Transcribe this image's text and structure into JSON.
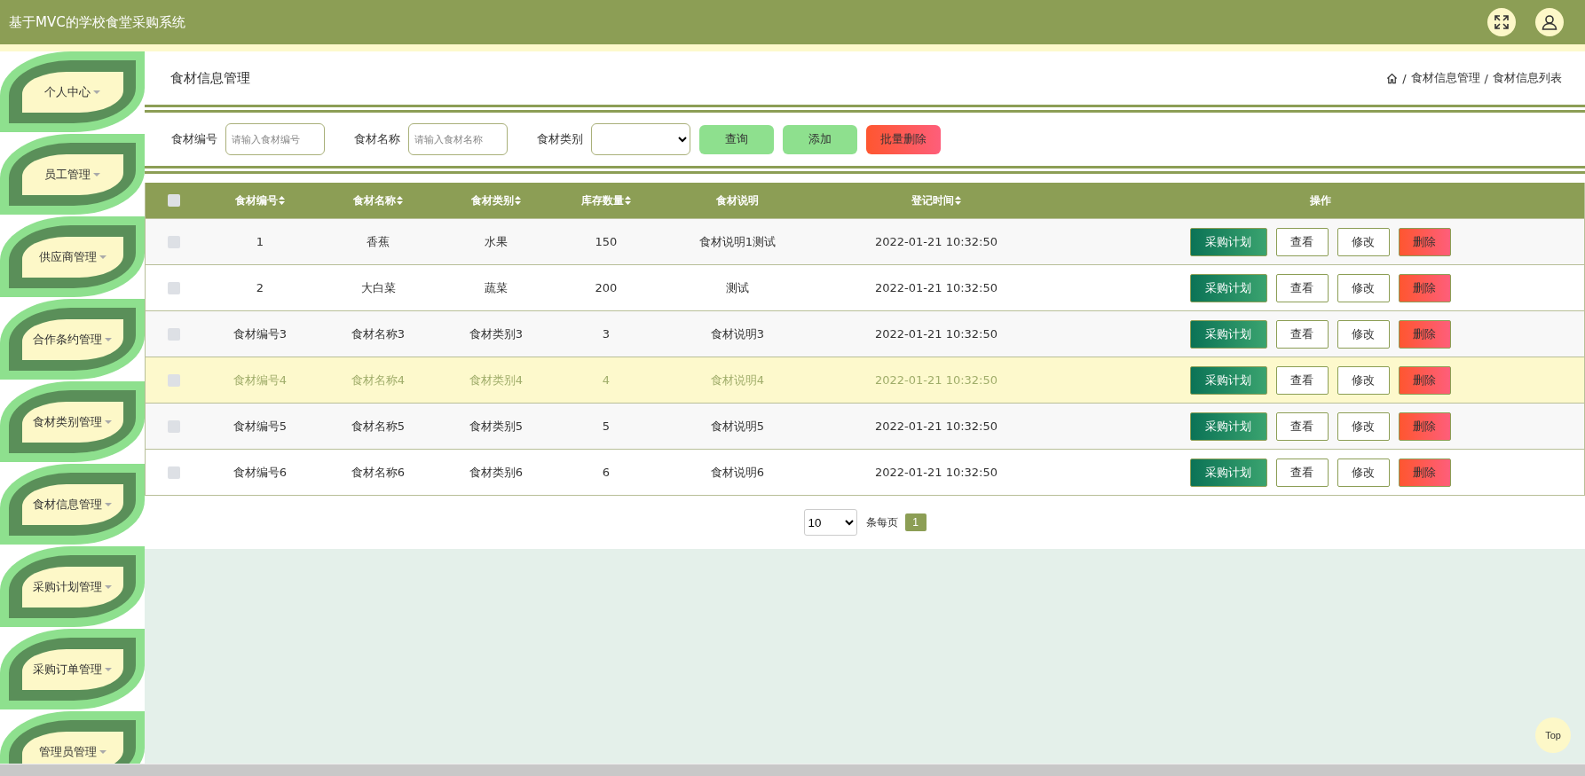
{
  "header": {
    "title": "基于MVC的学校食堂采购系统"
  },
  "sidebar": {
    "items": [
      {
        "label": "个人中心"
      },
      {
        "label": "员工管理"
      },
      {
        "label": "供应商管理"
      },
      {
        "label": "合作条约管理"
      },
      {
        "label": "食材类别管理"
      },
      {
        "label": "食材信息管理"
      },
      {
        "label": "采购计划管理"
      },
      {
        "label": "采购订单管理"
      },
      {
        "label": "管理员管理"
      }
    ]
  },
  "page": {
    "title": "食材信息管理",
    "breadcrumb": [
      {
        "separator": "/",
        "label": "食材信息管理"
      },
      {
        "separator": "/",
        "label": "食材信息列表"
      }
    ]
  },
  "search": {
    "fields": [
      {
        "kind": "input",
        "label": "食材编号",
        "placeholder": "请输入食材编号"
      },
      {
        "kind": "input",
        "label": "食材名称",
        "placeholder": "请输入食材名称"
      },
      {
        "kind": "select",
        "label": "食材类别"
      }
    ],
    "buttons": [
      {
        "kind": "query",
        "label": "查询"
      },
      {
        "kind": "add",
        "label": "添加"
      },
      {
        "kind": "danger",
        "label": "批量删除"
      }
    ]
  },
  "table": {
    "select_all_checked": false,
    "columns": [
      {
        "label": "食材编号",
        "sortable": true
      },
      {
        "label": "食材名称",
        "sortable": true
      },
      {
        "label": "食材类别",
        "sortable": true
      },
      {
        "label": "库存数量",
        "sortable": true
      },
      {
        "label": "食材说明",
        "sortable": false
      },
      {
        "label": "登记时间",
        "sortable": true
      },
      {
        "label": "操作",
        "sortable": false
      }
    ],
    "rows": [
      {
        "checked": false,
        "hovered": false,
        "cells": [
          "1",
          "香蕉",
          "水果",
          "150",
          "食材说明1测试",
          "2022-01-21 10:32:50"
        ],
        "actions": [
          "采购计划",
          "查看",
          "修改",
          "删除"
        ]
      },
      {
        "checked": false,
        "hovered": false,
        "cells": [
          "2",
          "大白菜",
          "蔬菜",
          "200",
          "测试",
          "2022-01-21 10:32:50"
        ],
        "actions": [
          "采购计划",
          "查看",
          "修改",
          "删除"
        ]
      },
      {
        "checked": false,
        "hovered": false,
        "cells": [
          "食材编号3",
          "食材名称3",
          "食材类别3",
          "3",
          "食材说明3",
          "2022-01-21 10:32:50"
        ],
        "actions": [
          "采购计划",
          "查看",
          "修改",
          "删除"
        ]
      },
      {
        "checked": false,
        "hovered": true,
        "cells": [
          "食材编号4",
          "食材名称4",
          "食材类别4",
          "4",
          "食材说明4",
          "2022-01-21 10:32:50"
        ],
        "actions": [
          "采购计划",
          "查看",
          "修改",
          "删除"
        ]
      },
      {
        "checked": false,
        "hovered": false,
        "cells": [
          "食材编号5",
          "食材名称5",
          "食材类别5",
          "5",
          "食材说明5",
          "2022-01-21 10:32:50"
        ],
        "actions": [
          "采购计划",
          "查看",
          "修改",
          "删除"
        ]
      },
      {
        "checked": false,
        "hovered": false,
        "cells": [
          "食材编号6",
          "食材名称6",
          "食材类别6",
          "6",
          "食材说明6",
          "2022-01-21 10:32:50"
        ],
        "actions": [
          "采购计划",
          "查看",
          "修改",
          "删除"
        ]
      }
    ]
  },
  "pagination": {
    "page_size": "10",
    "per_page_label": "条每页",
    "pages": [
      {
        "label": "1",
        "selected": true
      }
    ]
  },
  "back_to_top": "Top"
}
